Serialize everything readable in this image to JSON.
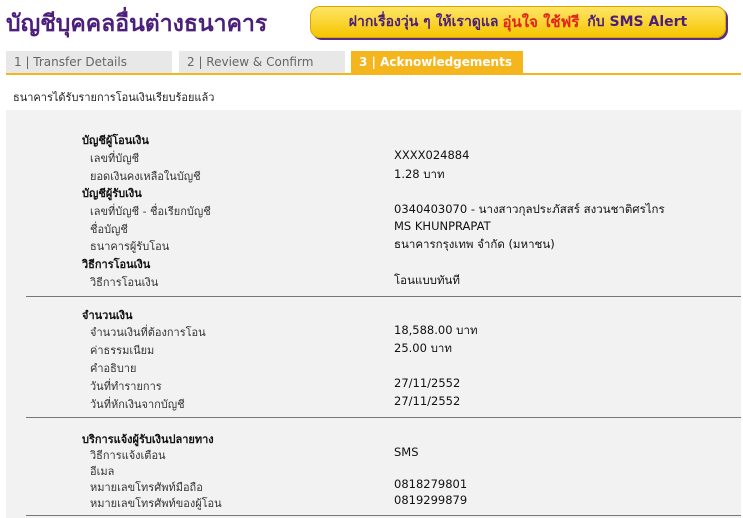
{
  "header": {
    "title": "บัญชีบุคคลอื่นต่างธนาคาร"
  },
  "promo": {
    "text_before": "ฝากเรื่องวุ่น ๆ ให้เราดูแล",
    "highlight": "อุ่นใจ ใช้ฟรี",
    "text_after": "กับ SMS Alert",
    "colors": {
      "background": "#f5c500",
      "text": "#4b1f7a",
      "highlight": "#e2231a"
    }
  },
  "tabs": [
    {
      "label": "1 | Transfer Details",
      "active": false
    },
    {
      "label": "2 | Review & Confirm",
      "active": false
    },
    {
      "label": "3 | Acknowledgements",
      "active": true
    }
  ],
  "status_message": "ธนาคารได้รับรายการโอนเงินเรียบร้อยแล้ว",
  "from_account": {
    "heading": "บัญชีผู้โอนเงิน",
    "account_no_label": "เลขที่บัญชี",
    "account_no": "XXXX024884",
    "balance_label": "ยอดเงินคงเหลือในบัญชี",
    "balance": "1.28 บาท"
  },
  "to_account": {
    "heading": "บัญชีผู้รับเงิน",
    "account_label": "เลขที่บัญชี - ชื่อเรียกบัญชี",
    "account": "0340403070 - นางสาวกุลประภัสสร์ สงวนชาติศรไกร",
    "name_label": "ชื่อบัญชี",
    "name": "MS KHUNPRAPAT",
    "bank_label": "ธนาคารผู้รับโอน",
    "bank": "ธนาคารกรุงเทพ จำกัด (มหาชน)"
  },
  "method": {
    "heading": "วิธีการโอนเงิน",
    "label": "วิธีการโอนเงิน",
    "value": "โอนแบบทันที"
  },
  "amount": {
    "heading": "จำนวนเงิน",
    "amount_label": "จำนวนเงินที่ต้องการโอน",
    "amount": "18,588.00 บาท",
    "fee_label": "ค่าธรรมเนียม",
    "fee": "25.00  บาท",
    "desc_label": "คำอธิบาย",
    "txn_date_label": "วันที่ทำรายการ",
    "txn_date": "27/11/2552",
    "debit_date_label": "วันที่หักเงินจากบัญชี",
    "debit_date": "27/11/2552"
  },
  "notify": {
    "heading": "บริการแจ้งผู้รับเงินปลายทาง",
    "method_label": "วิธีการแจ้งเตือน",
    "method": "SMS",
    "email_label": "อีเมล",
    "mobile_label": "หมายเลขโทรศัพท์มือถือ",
    "mobile": "0818279801",
    "sender_phone_label": "หมายเลขโทรศัพท์ของผู้โอน",
    "sender_phone": "0819299879"
  }
}
